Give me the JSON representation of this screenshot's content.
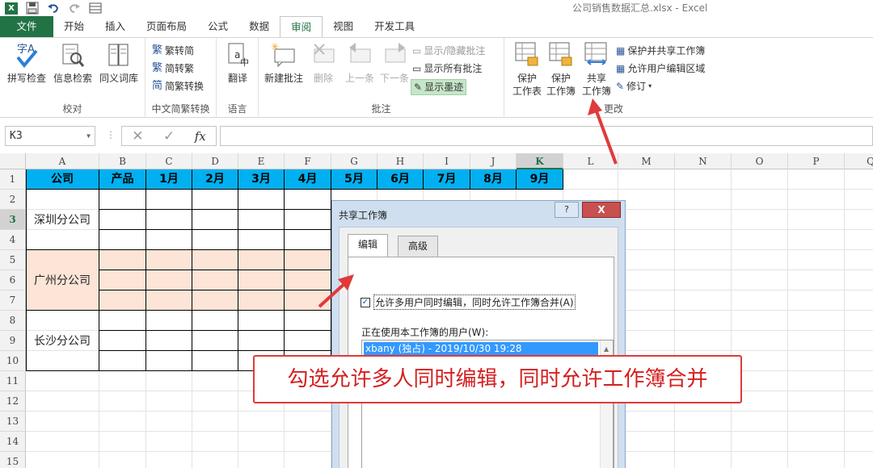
{
  "window": {
    "title": "公司销售数据汇总.xlsx - Excel"
  },
  "qat": {
    "logo": "X"
  },
  "tabs": [
    "文件",
    "开始",
    "插入",
    "页面布局",
    "公式",
    "数据",
    "审阅",
    "视图",
    "开发工具"
  ],
  "active_tab": "审阅",
  "ribbon": {
    "proofing": {
      "label": "校对",
      "spell": "拼写检查",
      "research": "信息检索",
      "thesaurus": "同义词库"
    },
    "chinese": {
      "label": "中文简繁转换",
      "t2s": "繁转简",
      "s2t": "简转繁",
      "convert": "简繁转换"
    },
    "language": {
      "label": "语言",
      "translate": "翻译"
    },
    "comments": {
      "label": "批注",
      "new": "新建批注",
      "delete": "删除",
      "prev": "上一条",
      "next": "下一条",
      "show_hide": "显示/隐藏批注",
      "show_all": "显示所有批注",
      "show_ink": "显示墨迹"
    },
    "changes": {
      "label": "更改",
      "protect_sheet_1": "保护",
      "protect_sheet_2": "工作表",
      "protect_wb_1": "保护",
      "protect_wb_2": "工作簿",
      "share_wb_1": "共享",
      "share_wb_2": "工作簿",
      "protect_share": "保护并共享工作簿",
      "allow_edit": "允许用户编辑区域",
      "track": "修订"
    }
  },
  "formula_bar": {
    "namebox": "K3",
    "fx": "fx",
    "cancel": "✕",
    "enter": "✓",
    "value": ""
  },
  "columns": [
    "A",
    "B",
    "C",
    "D",
    "E",
    "F",
    "G",
    "H",
    "I",
    "J",
    "K",
    "L",
    "M",
    "N",
    "O",
    "P",
    "Q"
  ],
  "selected_column": "K",
  "rows": [
    "1",
    "2",
    "3",
    "4",
    "5",
    "6",
    "7",
    "8",
    "9",
    "10",
    "11",
    "12",
    "13",
    "14",
    "15"
  ],
  "selected_row": "3",
  "table_header": [
    "公司",
    "产品",
    "1月",
    "2月",
    "3月",
    "4月",
    "5月",
    "6月",
    "7月",
    "8月",
    "9月"
  ],
  "companies": [
    "深圳分公司",
    "广州分公司",
    "长沙分公司"
  ],
  "dialog": {
    "title": "共享工作簿",
    "help": "?",
    "close": "X",
    "tabs": [
      "编辑",
      "高级"
    ],
    "checkbox_label": "允许多用户同时编辑，同时允许工作簿合并(A)",
    "checked": true,
    "users_label": "正在使用本工作簿的用户(W):",
    "users": [
      "xbany (独占) - 2019/10/30 19:28"
    ]
  },
  "annotation": "勾选允许多人同时编辑，同时允许工作簿合并",
  "colors": {
    "excel_green": "#217346",
    "header_blue": "#00b0f0",
    "peach": "#fce4d6",
    "annotation_red": "#e03a3a"
  }
}
